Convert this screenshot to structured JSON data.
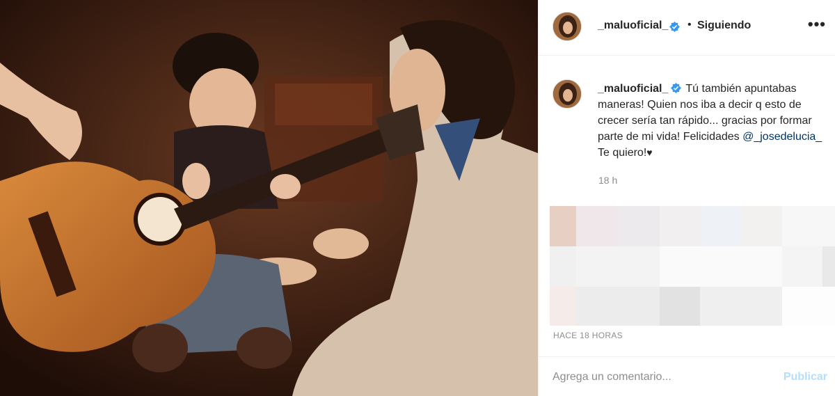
{
  "post": {
    "username": "_maluoficial_",
    "separator": "•",
    "follow_status": "Siguiendo",
    "more_icon": "more-options-icon",
    "caption_text": "Tú también apuntabas maneras! Quien nos iba a decir q esto de crecer sería tan rápido... gracias por formar parte de mi vida! Felicidades",
    "caption_mention": "@_josedelucia_",
    "caption_end": "Te quiero!",
    "caption_heart": "♥",
    "caption_age": "18 h",
    "timestamp": "HACE 18 HORAS"
  },
  "comment": {
    "placeholder": "Agrega un comentario...",
    "publish_label": "Publicar"
  },
  "colors": {
    "verified": "#3897f0",
    "publish_disabled": "#b2dffc",
    "mention": "#003569"
  }
}
